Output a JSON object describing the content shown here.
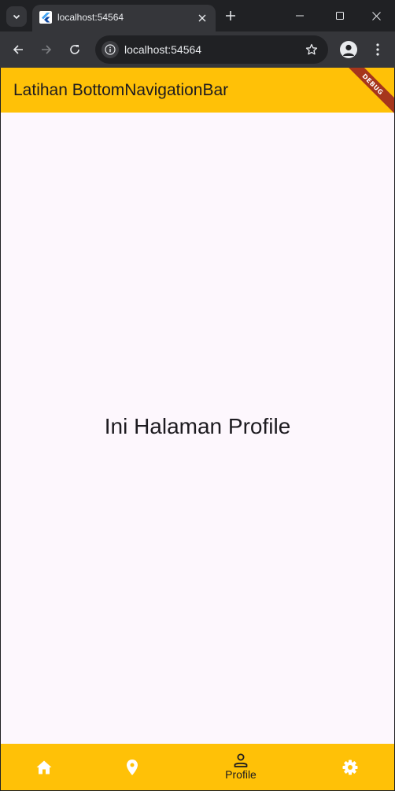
{
  "browser": {
    "tab_title": "localhost:54564",
    "url": "localhost:54564"
  },
  "app": {
    "title": "Latihan BottomNavigationBar",
    "debug_label": "DEBUG",
    "body_text": "Ini Halaman Profile",
    "colors": {
      "app_bar": "#ffc107",
      "background": "#fdf7fd",
      "debug_banner": "#a6361c"
    }
  },
  "bottom_nav": {
    "items": [
      {
        "icon": "home-icon",
        "label": "",
        "selected": false
      },
      {
        "icon": "location-pin-icon",
        "label": "",
        "selected": false
      },
      {
        "icon": "person-icon",
        "label": "Profile",
        "selected": true
      },
      {
        "icon": "gear-icon",
        "label": "",
        "selected": false
      }
    ]
  }
}
